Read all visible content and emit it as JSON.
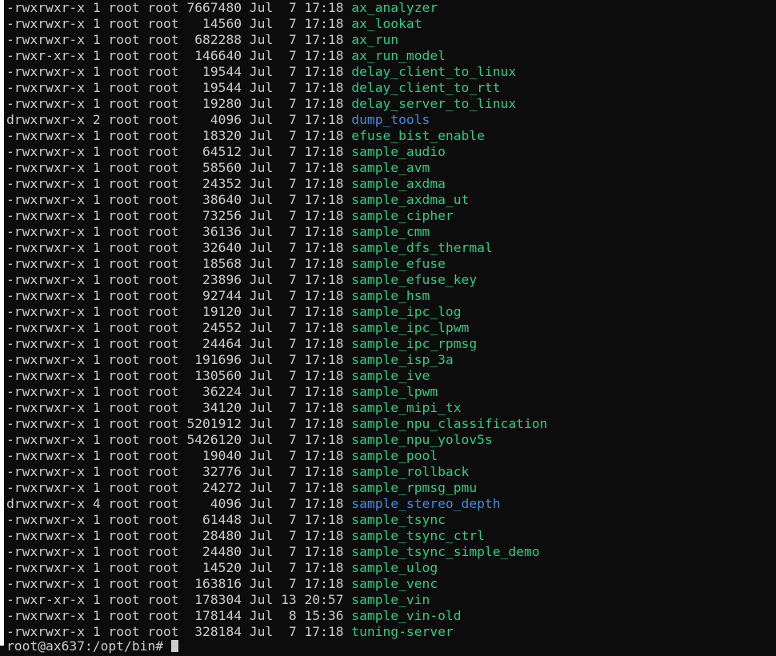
{
  "colors": {
    "background": "#0c0c0c",
    "text": "#cccccc",
    "executable": "#23d18b",
    "directory": "#3b8eea"
  },
  "listing": [
    {
      "meta": "-rwxrwxr-x 1 root root 7667480 Jul  7 17:18 ",
      "name": "ax_analyzer",
      "kind": "exec"
    },
    {
      "meta": "-rwxrwxr-x 1 root root   14560 Jul  7 17:18 ",
      "name": "ax_lookat",
      "kind": "exec"
    },
    {
      "meta": "-rwxrwxr-x 1 root root  682288 Jul  7 17:18 ",
      "name": "ax_run",
      "kind": "exec"
    },
    {
      "meta": "-rwxr-xr-x 1 root root  146640 Jul  7 17:18 ",
      "name": "ax_run_model",
      "kind": "exec"
    },
    {
      "meta": "-rwxrwxr-x 1 root root   19544 Jul  7 17:18 ",
      "name": "delay_client_to_linux",
      "kind": "exec"
    },
    {
      "meta": "-rwxrwxr-x 1 root root   19544 Jul  7 17:18 ",
      "name": "delay_client_to_rtt",
      "kind": "exec"
    },
    {
      "meta": "-rwxrwxr-x 1 root root   19280 Jul  7 17:18 ",
      "name": "delay_server_to_linux",
      "kind": "exec"
    },
    {
      "meta": "drwxrwxr-x 2 root root    4096 Jul  7 17:18 ",
      "name": "dump_tools",
      "kind": "dir"
    },
    {
      "meta": "-rwxrwxr-x 1 root root   18320 Jul  7 17:18 ",
      "name": "efuse_bist_enable",
      "kind": "exec"
    },
    {
      "meta": "-rwxrwxr-x 1 root root   64512 Jul  7 17:18 ",
      "name": "sample_audio",
      "kind": "exec"
    },
    {
      "meta": "-rwxrwxr-x 1 root root   58560 Jul  7 17:18 ",
      "name": "sample_avm",
      "kind": "exec"
    },
    {
      "meta": "-rwxrwxr-x 1 root root   24352 Jul  7 17:18 ",
      "name": "sample_axdma",
      "kind": "exec"
    },
    {
      "meta": "-rwxrwxr-x 1 root root   38640 Jul  7 17:18 ",
      "name": "sample_axdma_ut",
      "kind": "exec"
    },
    {
      "meta": "-rwxrwxr-x 1 root root   73256 Jul  7 17:18 ",
      "name": "sample_cipher",
      "kind": "exec"
    },
    {
      "meta": "-rwxrwxr-x 1 root root   36136 Jul  7 17:18 ",
      "name": "sample_cmm",
      "kind": "exec"
    },
    {
      "meta": "-rwxrwxr-x 1 root root   32640 Jul  7 17:18 ",
      "name": "sample_dfs_thermal",
      "kind": "exec"
    },
    {
      "meta": "-rwxrwxr-x 1 root root   18568 Jul  7 17:18 ",
      "name": "sample_efuse",
      "kind": "exec"
    },
    {
      "meta": "-rwxrwxr-x 1 root root   23896 Jul  7 17:18 ",
      "name": "sample_efuse_key",
      "kind": "exec"
    },
    {
      "meta": "-rwxrwxr-x 1 root root   92744 Jul  7 17:18 ",
      "name": "sample_hsm",
      "kind": "exec"
    },
    {
      "meta": "-rwxrwxr-x 1 root root   19120 Jul  7 17:18 ",
      "name": "sample_ipc_log",
      "kind": "exec"
    },
    {
      "meta": "-rwxrwxr-x 1 root root   24552 Jul  7 17:18 ",
      "name": "sample_ipc_lpwm",
      "kind": "exec"
    },
    {
      "meta": "-rwxrwxr-x 1 root root   24464 Jul  7 17:18 ",
      "name": "sample_ipc_rpmsg",
      "kind": "exec"
    },
    {
      "meta": "-rwxrwxr-x 1 root root  191696 Jul  7 17:18 ",
      "name": "sample_isp_3a",
      "kind": "exec"
    },
    {
      "meta": "-rwxrwxr-x 1 root root  130560 Jul  7 17:18 ",
      "name": "sample_ive",
      "kind": "exec"
    },
    {
      "meta": "-rwxrwxr-x 1 root root   36224 Jul  7 17:18 ",
      "name": "sample_lpwm",
      "kind": "exec"
    },
    {
      "meta": "-rwxrwxr-x 1 root root   34120 Jul  7 17:18 ",
      "name": "sample_mipi_tx",
      "kind": "exec"
    },
    {
      "meta": "-rwxrwxr-x 1 root root 5201912 Jul  7 17:18 ",
      "name": "sample_npu_classification",
      "kind": "exec"
    },
    {
      "meta": "-rwxrwxr-x 1 root root 5426120 Jul  7 17:18 ",
      "name": "sample_npu_yolov5s",
      "kind": "exec"
    },
    {
      "meta": "-rwxrwxr-x 1 root root   19040 Jul  7 17:18 ",
      "name": "sample_pool",
      "kind": "exec"
    },
    {
      "meta": "-rwxrwxr-x 1 root root   32776 Jul  7 17:18 ",
      "name": "sample_rollback",
      "kind": "exec"
    },
    {
      "meta": "-rwxrwxr-x 1 root root   24272 Jul  7 17:18 ",
      "name": "sample_rpmsg_pmu",
      "kind": "exec"
    },
    {
      "meta": "drwxrwxr-x 4 root root    4096 Jul  7 17:18 ",
      "name": "sample_stereo_depth",
      "kind": "dir"
    },
    {
      "meta": "-rwxrwxr-x 1 root root   61448 Jul  7 17:18 ",
      "name": "sample_tsync",
      "kind": "exec"
    },
    {
      "meta": "-rwxrwxr-x 1 root root   28480 Jul  7 17:18 ",
      "name": "sample_tsync_ctrl",
      "kind": "exec"
    },
    {
      "meta": "-rwxrwxr-x 1 root root   24480 Jul  7 17:18 ",
      "name": "sample_tsync_simple_demo",
      "kind": "exec"
    },
    {
      "meta": "-rwxrwxr-x 1 root root   14520 Jul  7 17:18 ",
      "name": "sample_ulog",
      "kind": "exec"
    },
    {
      "meta": "-rwxrwxr-x 1 root root  163816 Jul  7 17:18 ",
      "name": "sample_venc",
      "kind": "exec"
    },
    {
      "meta": "-rwxr-xr-x 1 root root  178304 Jul 13 20:57 ",
      "name": "sample_vin",
      "kind": "exec"
    },
    {
      "meta": "-rwxrwxr-x 1 root root  178144 Jul  8 15:36 ",
      "name": "sample_vin-old",
      "kind": "exec"
    },
    {
      "meta": "-rwxrwxr-x 1 root root  328184 Jul  7 17:18 ",
      "name": "tuning-server",
      "kind": "exec"
    }
  ],
  "prompt": "root@ax637:/opt/bin# "
}
